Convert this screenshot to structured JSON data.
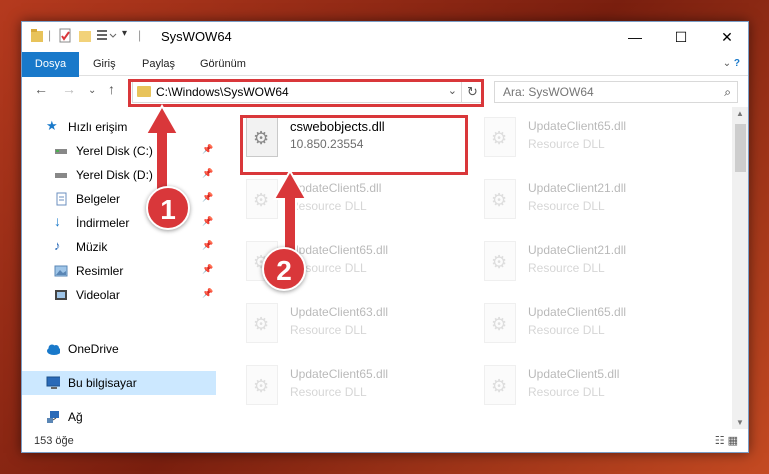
{
  "window": {
    "title": "SysWOW64",
    "minimize": "—",
    "maximize": "☐",
    "close": "✕"
  },
  "ribbon": {
    "tabs": [
      "Dosya",
      "Giriş",
      "Paylaş",
      "Görünüm"
    ]
  },
  "address": {
    "path": "C:\\Windows\\SysWOW64"
  },
  "search": {
    "placeholder": "Ara: SysWOW64"
  },
  "sidebar": {
    "items": [
      {
        "label": "Hızlı erişim",
        "icon": "star-icon"
      },
      {
        "label": "Yerel Disk (C:)",
        "icon": "drive-icon"
      },
      {
        "label": "Yerel Disk (D:)",
        "icon": "drive-icon"
      },
      {
        "label": "Belgeler",
        "icon": "documents-icon"
      },
      {
        "label": "İndirmeler",
        "icon": "download-icon"
      },
      {
        "label": "Müzik",
        "icon": "music-icon"
      },
      {
        "label": "Resimler",
        "icon": "pictures-icon"
      },
      {
        "label": "Videolar",
        "icon": "videos-icon"
      },
      {
        "label": "OneDrive",
        "icon": "cloud-icon"
      },
      {
        "label": "Bu bilgisayar",
        "icon": "computer-icon"
      },
      {
        "label": "Ağ",
        "icon": "network-icon"
      }
    ]
  },
  "files": {
    "main": {
      "name": "cswebobjects.dll",
      "desc": "10.850.23554"
    },
    "faded": [
      {
        "name": "UpdateClient65.dll",
        "desc": "Resource DLL"
      },
      {
        "name": "UpdateClient5.dll",
        "desc": "Resource DLL"
      },
      {
        "name": "UpdateClient21.dll",
        "desc": "Resource DLL"
      },
      {
        "name": "UpdateClient65.dll",
        "desc": "Resource DLL"
      },
      {
        "name": "UpdateClient21.dll",
        "desc": "Resource DLL"
      },
      {
        "name": "UpdateClient63.dll",
        "desc": "Resource DLL"
      },
      {
        "name": "UpdateClient65.dll",
        "desc": "Resource DLL"
      },
      {
        "name": "UpdateClient65.dll",
        "desc": "Resource DLL"
      },
      {
        "name": "UpdateClient5.dll",
        "desc": "Resource DLL"
      }
    ]
  },
  "status": {
    "count": "153 öğe"
  },
  "annotations": {
    "step1": "1",
    "step2": "2"
  },
  "colors": {
    "accent": "#1979ca",
    "highlight": "#d9373a",
    "selection": "#cce8ff"
  }
}
